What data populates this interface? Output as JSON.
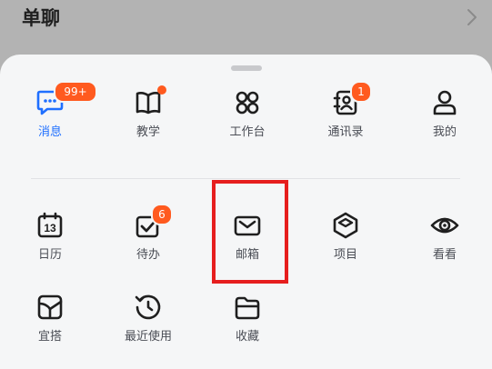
{
  "topbar": {
    "title": "单聊"
  },
  "row1": [
    {
      "label": "消息",
      "icon": "message-icon",
      "badge": "99+",
      "active": true
    },
    {
      "label": "教学",
      "icon": "book-icon"
    },
    {
      "label": "工作台",
      "icon": "workbench-icon"
    },
    {
      "label": "通讯录",
      "icon": "contacts-icon",
      "badge": "1"
    },
    {
      "label": "我的",
      "icon": "profile-icon"
    }
  ],
  "row2": [
    {
      "label": "日历",
      "icon": "calendar-icon",
      "date": "13"
    },
    {
      "label": "待办",
      "icon": "todo-icon",
      "badge": "6"
    },
    {
      "label": "邮箱",
      "icon": "mail-icon"
    },
    {
      "label": "项目",
      "icon": "project-icon"
    },
    {
      "label": "看看",
      "icon": "eye-icon"
    }
  ],
  "row3": [
    {
      "label": "宜搭",
      "icon": "yida-icon"
    },
    {
      "label": "最近使用",
      "icon": "history-icon"
    },
    {
      "label": "收藏",
      "icon": "folder-icon"
    }
  ],
  "colors": {
    "accent": "#1f6fff",
    "badge": "#ff5a1f",
    "highlight": "#e61e1e",
    "icon": "#1f1f1f"
  }
}
